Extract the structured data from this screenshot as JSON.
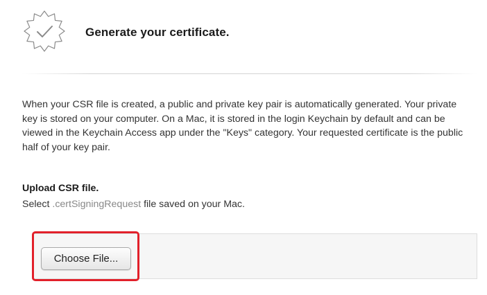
{
  "header": {
    "badge_icon": "certificate-seal-checkmark-icon",
    "title": "Generate your certificate."
  },
  "description": "When your CSR file is created, a public and private key pair is automatically generated. Your private key is stored on your computer. On a Mac, it is stored in the login Keychain by default and can be viewed in the Keychain Access app under the \"Keys\" category. Your requested certificate is the public half of your key pair.",
  "upload": {
    "heading": "Upload CSR file.",
    "instruction_prefix": "Select ",
    "file_extension": ".certSigningRequest",
    "instruction_suffix": " file saved on your Mac.",
    "choose_button_label": "Choose File...",
    "highlight_color": "#e2202a"
  }
}
